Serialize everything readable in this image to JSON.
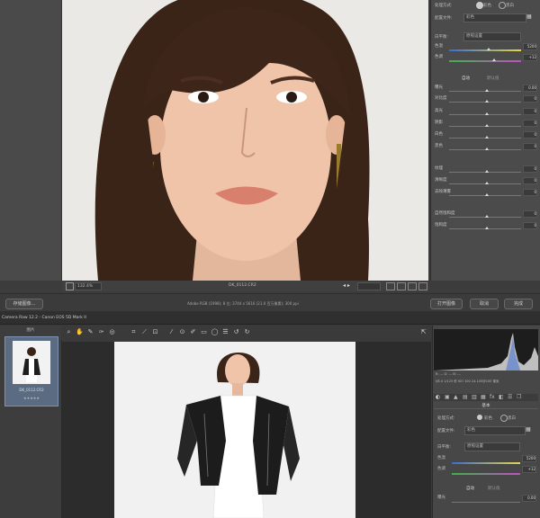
{
  "top_window": {
    "panel": {
      "treatment_label": "处理方式:",
      "treatment_options": [
        "彩色",
        "黑白"
      ],
      "profile_label": "配置文件:",
      "profile_value": "彩色",
      "wb_label": "白平衡:",
      "wb_value": "原照设置",
      "temp_label": "色温",
      "temp_value": "5200",
      "tint_label": "色调",
      "tint_value": "+12",
      "auto_label": "自动",
      "default_label": "默认值",
      "rows": [
        {
          "label": "曝光",
          "value": "0.00"
        },
        {
          "label": "对比度",
          "value": "0"
        },
        {
          "label": "高光",
          "value": "0"
        },
        {
          "label": "阴影",
          "value": "0"
        },
        {
          "label": "白色",
          "value": "0"
        },
        {
          "label": "黑色",
          "value": "0"
        },
        {
          "label": "纹理",
          "value": "0"
        },
        {
          "label": "清晰度",
          "value": "0"
        },
        {
          "label": "去除薄雾",
          "value": "0"
        },
        {
          "label": "自然饱和度",
          "value": "0"
        },
        {
          "label": "饱和度",
          "value": "0"
        }
      ]
    },
    "status": {
      "zoom": "132.4%",
      "filename": "DK_0112.CR2"
    },
    "bottom_bar": {
      "save_button": "存储图像...",
      "info": "Adobe RGB (1998); 8 位; 3744 x 5616 (21.0 百万像素); 300 ppi",
      "open_button": "打开图像",
      "cancel_button": "取消",
      "done_button": "完成"
    }
  },
  "bottom_window": {
    "title": "Camera Raw 12.2 - Canon EOS 5D Mark II",
    "filmstrip": {
      "header": "图片",
      "thumb_label": "DK_0112.CR2",
      "stars": "★★★★★"
    },
    "toolbar_icons": [
      "zoom-icon",
      "hand-icon",
      "white-balance-icon",
      "color-sampler-icon",
      "target-adjust-icon",
      "crop-icon",
      "straighten-icon",
      "transform-icon",
      "spot-removal-icon",
      "red-eye-icon",
      "adjustment-brush-icon",
      "graduated-filter-icon",
      "radial-filter-icon",
      "preferences-icon",
      "rotate-left-icon",
      "rotate-right-icon"
    ],
    "panel": {
      "histogram_readout": "R: ---  G: ---  B: ---",
      "exif": "f/8.0  1/125 秒  ISO 100  24-105@105 毫米",
      "section_title": "基本",
      "treatment_label": "处理方式:",
      "treatment_options": [
        "彩色",
        "黑白"
      ],
      "profile_label": "配置文件:",
      "profile_value": "彩色",
      "wb_label": "白平衡:",
      "wb_value": "原照设置",
      "temp_label": "色温",
      "temp_value": "5200",
      "tint_label": "色调",
      "tint_value": "+12",
      "auto_label": "自动",
      "default_label": "默认值",
      "exposure_label": "曝光",
      "exposure_value": "0.00"
    }
  }
}
